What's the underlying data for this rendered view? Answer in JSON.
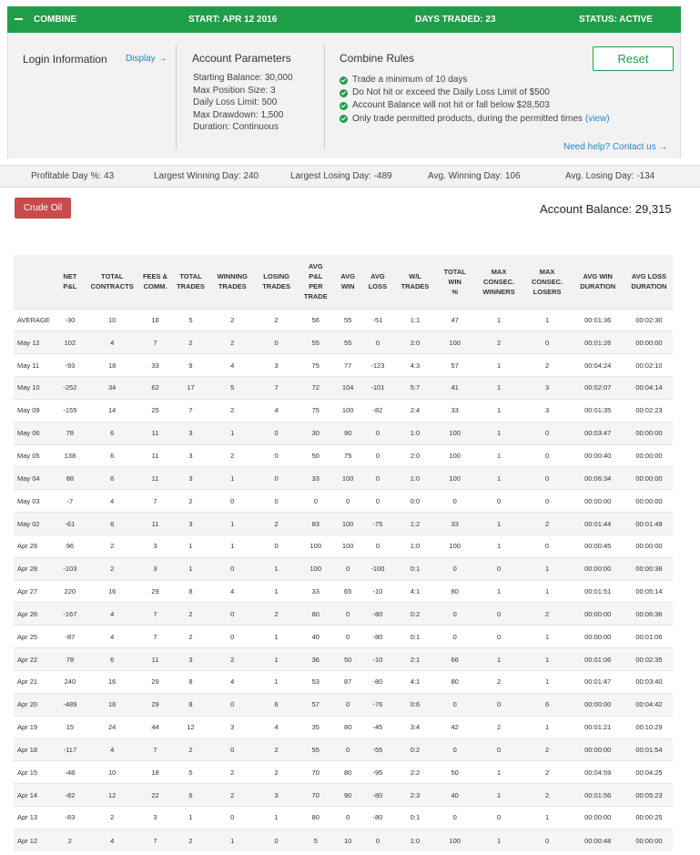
{
  "header": {
    "title": "COMBINE",
    "start": "START: APR 12 2016",
    "days_traded": "DAYS TRADED: 23",
    "status": "STATUS: ACTIVE",
    "accent": "#1f9e48"
  },
  "login": {
    "title": "Login Information",
    "display_link": "Display →"
  },
  "account_parameters": {
    "title": "Account Parameters",
    "items": [
      "Starting Balance: 30,000",
      "Max Position Size: 3",
      "Daily Loss Limit: 500",
      "Max Drawdown: 1,500",
      "Duration: Continuous"
    ]
  },
  "combine_rules": {
    "title": "Combine Rules",
    "items": [
      "Trade a minimum of 10 days",
      "Do Not hit or exceed the Daily Loss Limit of $500",
      "Account Balance will not hit or fall below $28,503",
      "Only trade permitted products, during the permitted times"
    ],
    "view_link": "(view)",
    "check_icon": "check-circle-icon"
  },
  "reset_label": "Reset",
  "help_link": "Need help? Contact us →",
  "stats": {
    "profitable_day": "Profitable Day %: 43",
    "largest_win": "Largest Winning Day: 240",
    "largest_loss": "Largest Losing Day: -489",
    "avg_win": "Avg. Winning Day: 106",
    "avg_loss": "Avg. Losing Day: -134"
  },
  "product_button": {
    "label": "Crude Oil",
    "color": "#c94a4a"
  },
  "account_balance": "Account Balance: 29,315",
  "table": {
    "headers": [
      [
        ""
      ],
      [
        "NET",
        "P&L"
      ],
      [
        "TOTAL",
        "CONTRACTS"
      ],
      [
        "FEES &",
        "COMM."
      ],
      [
        "TOTAL",
        "TRADES"
      ],
      [
        "WINNING",
        "TRADES"
      ],
      [
        "LOSING",
        "TRADES"
      ],
      [
        "AVG",
        "P&L",
        "PER",
        "TRADE"
      ],
      [
        "AVG",
        "WIN"
      ],
      [
        "AVG",
        "LOSS"
      ],
      [
        "W/L",
        "TRADES"
      ],
      [
        "TOTAL",
        "WIN",
        "%"
      ],
      [
        "MAX",
        "CONSEC.",
        "WINNERS"
      ],
      [
        "MAX",
        "CONSEC.",
        "LOSERS"
      ],
      [
        "AVG WIN",
        "DURATION"
      ],
      [
        "AVG LOSS",
        "DURATION"
      ]
    ],
    "rows": [
      [
        "AVERAGE",
        "-30",
        "10",
        "18",
        "5",
        "2",
        "2",
        "56",
        "55",
        "-51",
        "1:1",
        "47",
        "1",
        "1",
        "00:01:36",
        "00:02:30"
      ],
      [
        "May 12",
        "102",
        "4",
        "7",
        "2",
        "2",
        "0",
        "55",
        "55",
        "0",
        "2:0",
        "100",
        "2",
        "0",
        "00:01:26",
        "00:00:00"
      ],
      [
        "May 11",
        "-93",
        "18",
        "33",
        "9",
        "4",
        "3",
        "75",
        "77",
        "-123",
        "4:3",
        "57",
        "1",
        "2",
        "00:04:24",
        "00:02:10"
      ],
      [
        "May 10",
        "-252",
        "34",
        "62",
        "17",
        "5",
        "7",
        "72",
        "104",
        "-101",
        "5:7",
        "41",
        "1",
        "3",
        "00:02:07",
        "00:04:14"
      ],
      [
        "May 09",
        "-155",
        "14",
        "25",
        "7",
        "2",
        "4",
        "75",
        "100",
        "-82",
        "2:4",
        "33",
        "1",
        "3",
        "00:01:35",
        "00:02:23"
      ],
      [
        "May 06",
        "78",
        "6",
        "11",
        "3",
        "1",
        "0",
        "30",
        "90",
        "0",
        "1:0",
        "100",
        "1",
        "0",
        "00:03:47",
        "00:00:00"
      ],
      [
        "May 05",
        "138",
        "6",
        "11",
        "3",
        "2",
        "0",
        "50",
        "75",
        "0",
        "2:0",
        "100",
        "1",
        "0",
        "00:00:40",
        "00:00:00"
      ],
      [
        "May 04",
        "88",
        "6",
        "11",
        "3",
        "1",
        "0",
        "33",
        "100",
        "0",
        "1:0",
        "100",
        "1",
        "0",
        "00:06:34",
        "00:00:00"
      ],
      [
        "May 03",
        "-7",
        "4",
        "7",
        "2",
        "0",
        "0",
        "0",
        "0",
        "0",
        "0:0",
        "0",
        "0",
        "0",
        "00:00:00",
        "00:00:00"
      ],
      [
        "May 02",
        "-61",
        "6",
        "11",
        "3",
        "1",
        "2",
        "83",
        "100",
        "-75",
        "1:2",
        "33",
        "1",
        "2",
        "00:01:44",
        "00:01:49"
      ],
      [
        "Apr 29",
        "96",
        "2",
        "3",
        "1",
        "1",
        "0",
        "100",
        "100",
        "0",
        "1:0",
        "100",
        "1",
        "0",
        "00:00:45",
        "00:00:00"
      ],
      [
        "Apr 28",
        "-103",
        "2",
        "3",
        "1",
        "0",
        "1",
        "100",
        "0",
        "-100",
        "0:1",
        "0",
        "0",
        "1",
        "00:00:00",
        "00:00:38"
      ],
      [
        "Apr 27",
        "220",
        "16",
        "29",
        "8",
        "4",
        "1",
        "33",
        "65",
        "-10",
        "4:1",
        "80",
        "1",
        "1",
        "00:01:51",
        "00:05:14"
      ],
      [
        "Apr 26",
        "-167",
        "4",
        "7",
        "2",
        "0",
        "2",
        "80",
        "0",
        "-80",
        "0:2",
        "0",
        "0",
        "2",
        "00:00:00",
        "00:06:36"
      ],
      [
        "Apr 25",
        "-87",
        "4",
        "7",
        "2",
        "0",
        "1",
        "40",
        "0",
        "-80",
        "0:1",
        "0",
        "0",
        "1",
        "00:00:00",
        "00:01:06"
      ],
      [
        "Apr 22",
        "78",
        "6",
        "11",
        "3",
        "2",
        "1",
        "36",
        "50",
        "-10",
        "2:1",
        "66",
        "1",
        "1",
        "00:01:06",
        "00:02:35"
      ],
      [
        "Apr 21",
        "240",
        "16",
        "29",
        "8",
        "4",
        "1",
        "53",
        "87",
        "-80",
        "4:1",
        "80",
        "2",
        "1",
        "00:01:47",
        "00:03:40"
      ],
      [
        "Apr 20",
        "-489",
        "16",
        "29",
        "8",
        "0",
        "6",
        "57",
        "0",
        "-76",
        "0:6",
        "0",
        "0",
        "6",
        "00:00:00",
        "00:04:42"
      ],
      [
        "Apr 19",
        "15",
        "24",
        "44",
        "12",
        "3",
        "4",
        "35",
        "80",
        "-45",
        "3:4",
        "42",
        "2",
        "1",
        "00:01:21",
        "00:10:29"
      ],
      [
        "Apr 18",
        "-117",
        "4",
        "7",
        "2",
        "0",
        "2",
        "55",
        "0",
        "-55",
        "0:2",
        "0",
        "0",
        "2",
        "00:00:00",
        "00:01:54"
      ],
      [
        "Apr 15",
        "-48",
        "10",
        "18",
        "5",
        "2",
        "2",
        "70",
        "80",
        "-95",
        "2:2",
        "50",
        "1",
        "2",
        "00:04:59",
        "00:04:25"
      ],
      [
        "Apr 14",
        "-82",
        "12",
        "22",
        "6",
        "2",
        "3",
        "70",
        "90",
        "-80",
        "2:3",
        "40",
        "1",
        "2",
        "00:01:56",
        "00:05:23"
      ],
      [
        "Apr 13",
        "-83",
        "2",
        "3",
        "1",
        "0",
        "1",
        "80",
        "0",
        "-80",
        "0:1",
        "0",
        "0",
        "1",
        "00:00:00",
        "00:00:25"
      ],
      [
        "Apr 12",
        "2",
        "4",
        "7",
        "2",
        "1",
        "0",
        "5",
        "10",
        "0",
        "1:0",
        "100",
        "1",
        "0",
        "00:00:48",
        "00:00:00"
      ]
    ]
  }
}
